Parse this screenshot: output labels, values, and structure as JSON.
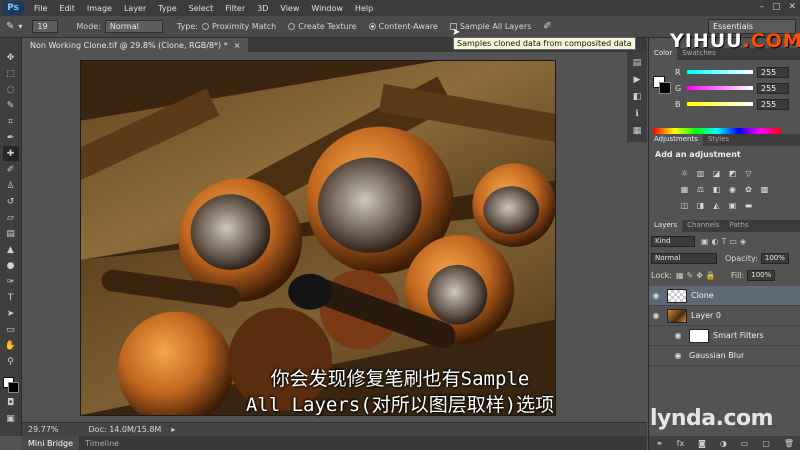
{
  "app": {
    "logo": "Ps"
  },
  "menu": [
    "File",
    "Edit",
    "Image",
    "Layer",
    "Type",
    "Select",
    "Filter",
    "3D",
    "View",
    "Window",
    "Help"
  ],
  "window_controls": [
    "–",
    "□",
    "✕"
  ],
  "options_bar": {
    "brush_size": "19",
    "mode_label": "Mode:",
    "mode_value": "Normal",
    "type_label": "Type:",
    "type_options": [
      "Proximity Match",
      "Create Texture",
      "Content-Aware"
    ],
    "sample_all_layers_label": "Sample All Layers",
    "workspace": "Essentials"
  },
  "tooltip": "Samples cloned data from composited data",
  "watermark": {
    "text": "YIHUU",
    "suffix": ".COM"
  },
  "document_tab": {
    "title": "Non Working Clone.tif @ 29.8% (Clone, RGB/8*) *",
    "close": "×"
  },
  "subtitle": {
    "line1": "你会发现修复笔刷也有Sample",
    "line2": "All Layers(对所以图层取样)选项"
  },
  "status_bar": {
    "zoom": "29.77%",
    "doc": "Doc: 14.0M/15.8M"
  },
  "bottom_tabs": [
    "Mini Bridge",
    "Timeline"
  ],
  "color_panel": {
    "tabs": [
      "Color",
      "Swatches"
    ],
    "channels": [
      {
        "letter": "R",
        "value": "255"
      },
      {
        "letter": "G",
        "value": "255"
      },
      {
        "letter": "B",
        "value": "255"
      }
    ]
  },
  "adjustments_panel": {
    "tabs": [
      "Adjustments",
      "Styles"
    ],
    "title": "Add an adjustment"
  },
  "layers_panel": {
    "tabs": [
      "Layers",
      "Channels",
      "Paths"
    ],
    "filter_kind": "Kind",
    "blend_mode": "Normal",
    "opacity_label": "Opacity:",
    "opacity_value": "100%",
    "lock_label": "Lock:",
    "fill_label": "Fill:",
    "fill_value": "100%",
    "layers": [
      {
        "name": "Clone"
      },
      {
        "name": "Layer 0"
      },
      {
        "name": "Smart Filters"
      },
      {
        "name": "Gaussian Blur"
      }
    ]
  },
  "lynda": "lynda.com"
}
